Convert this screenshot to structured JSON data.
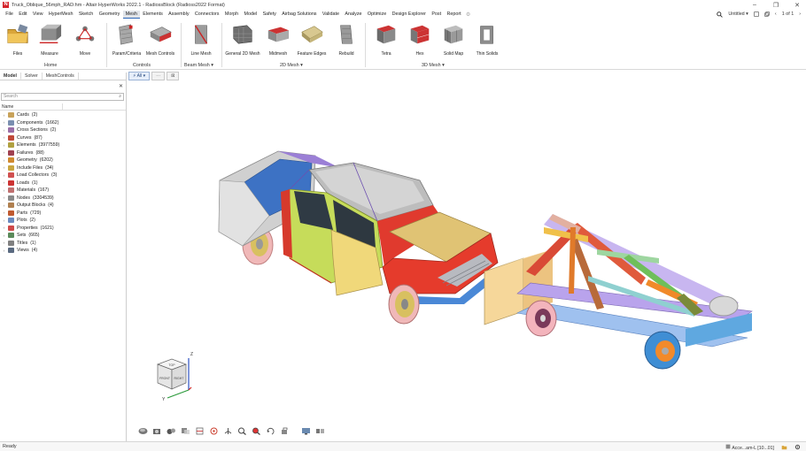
{
  "window": {
    "title": "Truck_Oblique_56mph_RAD.hm - Altair HyperWorks 2022.1 - RadiossBlock (Radioss2022 Format)",
    "logo_letter": "N",
    "minimize": "–",
    "maximize": "❐",
    "close": "✕"
  },
  "menubar": {
    "items": [
      "File",
      "Edit",
      "View",
      "HyperMesh",
      "Sketch",
      "Geometry",
      "Mesh",
      "Elements",
      "Assembly",
      "Connectors",
      "Morph",
      "Model",
      "Safety",
      "Airbag Solutions",
      "Validate",
      "Analyze",
      "Optimize",
      "Design Explorer",
      "Post",
      "Report"
    ],
    "active": "Mesh",
    "session": "Untitled",
    "page_counter": "1 of 1"
  },
  "ribbon": {
    "tools": {
      "files": "Files",
      "measure": "Measure",
      "move": "Move",
      "param_criteria": "Param/Criteria",
      "mesh_controls": "Mesh Controls",
      "line_mesh": "Line Mesh",
      "general_2d_mesh": "General 2D Mesh",
      "midmesh": "Midmesh",
      "feature_edges": "Feature Edges",
      "rebuild": "Rebuild",
      "tetra": "Tetra",
      "hex": "Hex",
      "solid_map": "Solid Map",
      "thin_solids": "Thin Solids"
    },
    "groups": {
      "home": "Home",
      "controls": "Controls",
      "beam_mesh": "Beam Mesh",
      "mesh_2d": "2D Mesh",
      "mesh_3d": "3D Mesh"
    }
  },
  "subbar": {
    "filter": "All",
    "btn2": "···",
    "btn3": "⊠"
  },
  "panel": {
    "tabs": [
      "Model",
      "Solver",
      "MeshControls"
    ],
    "active_tab": "Model",
    "search_placeholder": "Search",
    "col_name": "Name",
    "tree": [
      {
        "label": "Cards",
        "count": "(2)",
        "color": "#c8a25a"
      },
      {
        "label": "Components",
        "count": "(1662)",
        "color": "#7a8fb0"
      },
      {
        "label": "Cross Sections",
        "count": "(2)",
        "color": "#9a6fa8"
      },
      {
        "label": "Curves",
        "count": "(87)",
        "color": "#c04a3a"
      },
      {
        "label": "Elements",
        "count": "(3977559)",
        "color": "#b0a040"
      },
      {
        "label": "Failures",
        "count": "(88)",
        "color": "#a04050"
      },
      {
        "label": "Geometry",
        "count": "(6202)",
        "color": "#d08a30"
      },
      {
        "label": "Include Files",
        "count": "(34)",
        "color": "#c9a640"
      },
      {
        "label": "Load Collectors",
        "count": "(3)",
        "color": "#d05050"
      },
      {
        "label": "Loads",
        "count": "(1)",
        "color": "#cc3333"
      },
      {
        "label": "Materials",
        "count": "(167)",
        "color": "#c07070"
      },
      {
        "label": "Nodes",
        "count": "(3304539)",
        "color": "#8a8a8a"
      },
      {
        "label": "Output Blocks",
        "count": "(4)",
        "color": "#b08050"
      },
      {
        "label": "Parts",
        "count": "(729)",
        "color": "#c05a30"
      },
      {
        "label": "Plots",
        "count": "(2)",
        "color": "#6a8ac0"
      },
      {
        "label": "Properties",
        "count": "(1621)",
        "color": "#cf4a4a"
      },
      {
        "label": "Sets",
        "count": "(665)",
        "color": "#5a8a5a"
      },
      {
        "label": "Titles",
        "count": "(1)",
        "color": "#808080"
      },
      {
        "label": "Views",
        "count": "(4)",
        "color": "#5a6a80"
      }
    ]
  },
  "viewport": {
    "triad_z": "Z",
    "triad_y": "Y",
    "cube_top": "TOP",
    "cube_front": "FRONT",
    "cube_right": "RIGHT"
  },
  "status": {
    "ready": "Ready",
    "component": "Acce...am-L [10...01]"
  }
}
